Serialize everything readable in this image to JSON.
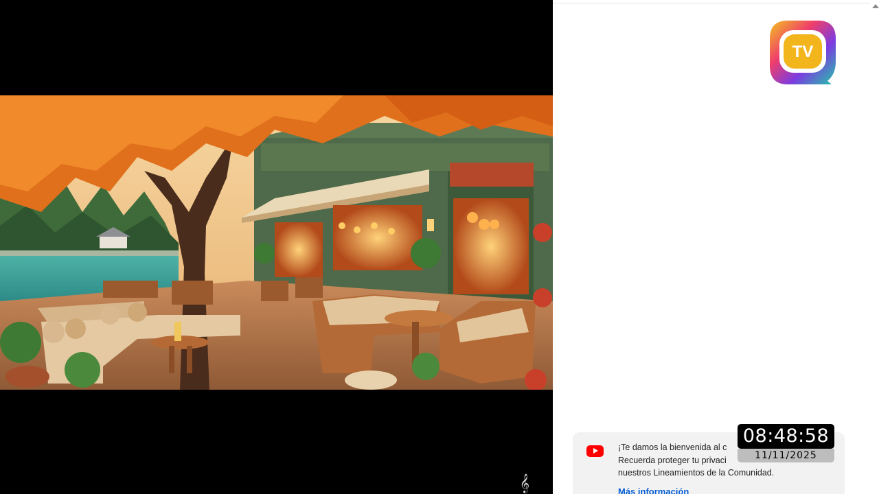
{
  "video": {
    "music_note_glyph": "𝄞",
    "icons": {
      "music": "treble-clef-icon"
    }
  },
  "side_panel": {
    "logo_text": "TV",
    "welcome": {
      "line1": "¡Te damos la bienvenida al c",
      "line2": "Recuerda proteger tu privaci",
      "line3": "nuestros Lineamientos de la Comunidad.",
      "link": "Más información",
      "icon": "youtube-icon"
    }
  },
  "clock": {
    "time": "08:48:58",
    "date": "11/11/2025"
  },
  "colors": {
    "youtube_red": "#ff0000",
    "link_blue": "#065fd4",
    "card_bg": "#f2f2f2"
  }
}
